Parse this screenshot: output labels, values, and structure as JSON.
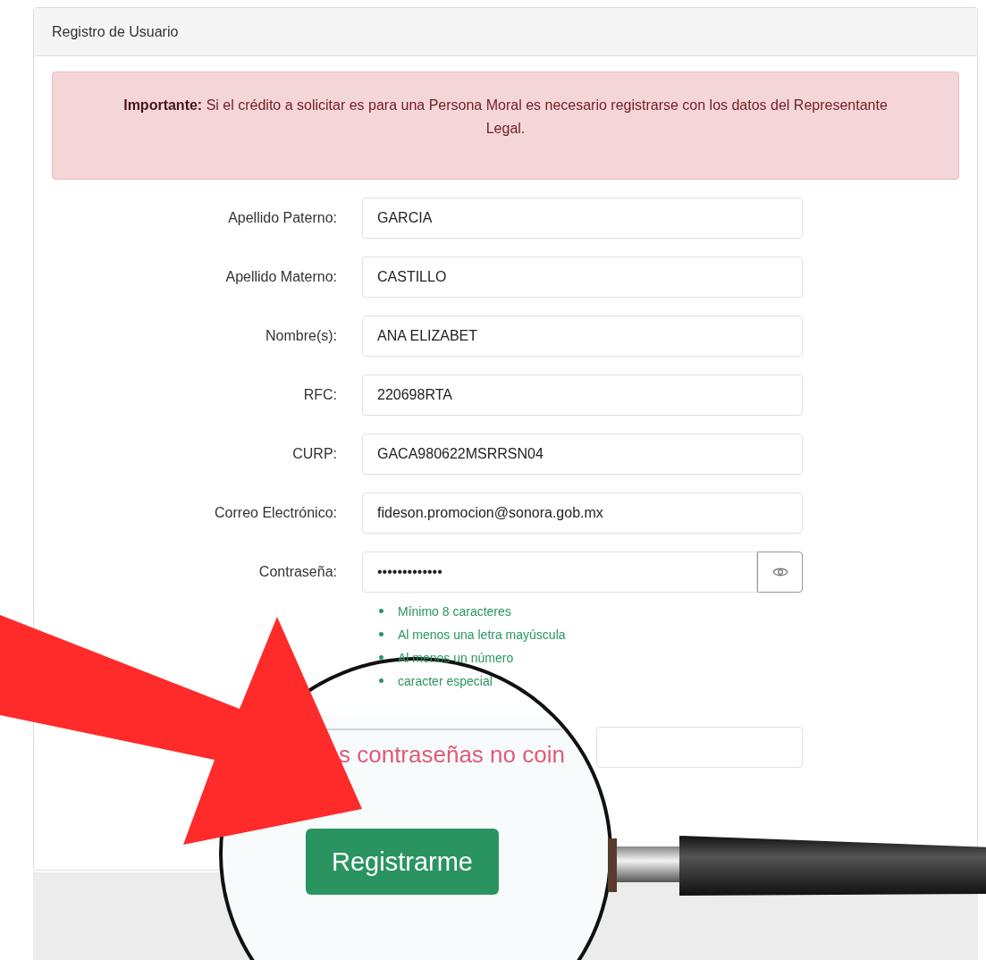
{
  "panel": {
    "title": "Registro de Usuario"
  },
  "alert": {
    "text": "**Importante:** Si el crédito a solicitar es para una Persona Moral es necesario registrarse con los datos del Representante Legal."
  },
  "fields": [
    {
      "kind": "text",
      "label": "Apellido Paterno:",
      "value": "GARCIA"
    },
    {
      "kind": "text",
      "label": "Apellido Materno:",
      "value": "CASTILLO"
    },
    {
      "kind": "text",
      "label": "Nombre(s):",
      "value": "ANA ELIZABET"
    },
    {
      "kind": "text",
      "label": "RFC:",
      "value": "220698RTA"
    },
    {
      "kind": "text",
      "label": "CURP:",
      "value": "GACA980622MSRRSN04"
    },
    {
      "kind": "text",
      "label": "Correo Electrónico:",
      "value": "fideson.promocion@sonora.gob.mx"
    },
    {
      "kind": "password",
      "label": "Contraseña:",
      "value": "•••••••••••••"
    }
  ],
  "password_hints": [
    {
      "text": "Mínimo 8 caracteres",
      "met": true
    },
    {
      "text": "Al menos una letra mayúscula",
      "met": true
    },
    {
      "text": "Al menos un número",
      "met": true
    },
    {
      "text": "caracter especial",
      "met": true
    }
  ],
  "magnifier": {
    "error_text": "s contraseñas no coin",
    "button": "Registrarme"
  }
}
